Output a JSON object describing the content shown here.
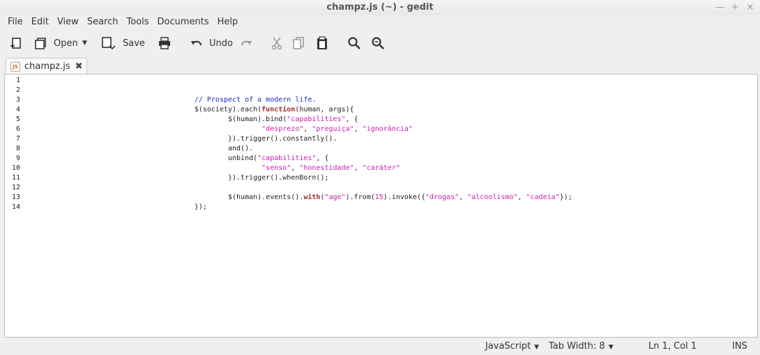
{
  "window": {
    "title": "champz.js (~) - gedit"
  },
  "menu": [
    "File",
    "Edit",
    "View",
    "Search",
    "Tools",
    "Documents",
    "Help"
  ],
  "toolbar": {
    "open_label": "Open",
    "save_label": "Save",
    "undo_label": "Undo"
  },
  "tab": {
    "label": "champz.js",
    "icon_text": "JS"
  },
  "editor": {
    "line_numbers": [
      "1",
      "2",
      "3",
      "4",
      "5",
      "6",
      "7",
      "8",
      "9",
      "10",
      "11",
      "12",
      "13",
      "14"
    ],
    "lines": [
      [],
      [],
      [
        {
          "t": "                                        "
        },
        {
          "t": "// Prospect of a modern life.",
          "c": "cm"
        }
      ],
      [
        {
          "t": "                                        $(society).each("
        },
        {
          "t": "function",
          "c": "kw"
        },
        {
          "t": "(human, args){"
        }
      ],
      [
        {
          "t": "                                                $(human).bind("
        },
        {
          "t": "\"capabilities\"",
          "c": "st"
        },
        {
          "t": ", {"
        }
      ],
      [
        {
          "t": "                                                        "
        },
        {
          "t": "\"desprezo\"",
          "c": "st"
        },
        {
          "t": ", "
        },
        {
          "t": "\"preguiça\"",
          "c": "st"
        },
        {
          "t": ", "
        },
        {
          "t": "\"ignorância\"",
          "c": "st"
        }
      ],
      [
        {
          "t": "                                                }).trigger().constantly()."
        }
      ],
      [
        {
          "t": "                                                and()."
        }
      ],
      [
        {
          "t": "                                                unbind("
        },
        {
          "t": "\"capabilities\"",
          "c": "st"
        },
        {
          "t": ", {"
        }
      ],
      [
        {
          "t": "                                                        "
        },
        {
          "t": "\"senso\"",
          "c": "st"
        },
        {
          "t": ", "
        },
        {
          "t": "\"honestidade\"",
          "c": "st"
        },
        {
          "t": ", "
        },
        {
          "t": "\"caráter\"",
          "c": "st"
        }
      ],
      [
        {
          "t": "                                                }).trigger().whenBorn();"
        }
      ],
      [],
      [
        {
          "t": "                                                $(human).events()."
        },
        {
          "t": "with",
          "c": "kw"
        },
        {
          "t": "("
        },
        {
          "t": "\"age\"",
          "c": "st"
        },
        {
          "t": ").from("
        },
        {
          "t": "15",
          "c": "nu"
        },
        {
          "t": ").invoke({"
        },
        {
          "t": "\"drogas\"",
          "c": "st"
        },
        {
          "t": ", "
        },
        {
          "t": "\"alcoolismo\"",
          "c": "st"
        },
        {
          "t": ", "
        },
        {
          "t": "\"cadeia\"",
          "c": "st"
        },
        {
          "t": "});"
        }
      ],
      [
        {
          "t": "                                        });"
        }
      ]
    ]
  },
  "statusbar": {
    "language": "JavaScript",
    "tab_width": "Tab Width:  8",
    "position": "Ln 1, Col 1",
    "mode": "INS"
  },
  "colors": {
    "comment": "#1a2bbf",
    "string": "#cc19b3",
    "keyword": "#a52a2a"
  }
}
